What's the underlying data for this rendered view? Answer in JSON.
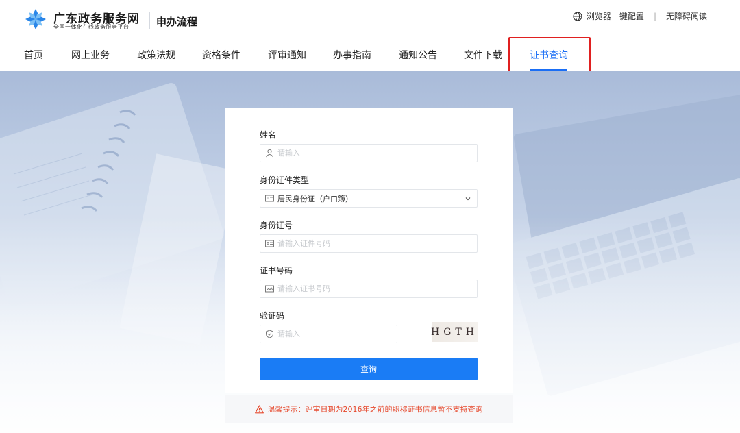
{
  "header": {
    "logo_title": "广东政务服务网",
    "logo_subtitle": "全国一体化在线政务服务平台",
    "section_title": "申办流程",
    "browser_config": "浏览器一键配置",
    "separator": "|",
    "accessibility": "无障碍阅读"
  },
  "nav": {
    "items": [
      {
        "label": "首页"
      },
      {
        "label": "网上业务"
      },
      {
        "label": "政策法规"
      },
      {
        "label": "资格条件"
      },
      {
        "label": "评审通知"
      },
      {
        "label": "办事指南"
      },
      {
        "label": "通知公告"
      },
      {
        "label": "文件下载"
      },
      {
        "label": "证书查询"
      }
    ],
    "active_index": 8
  },
  "form": {
    "name_label": "姓名",
    "name_placeholder": "请输入",
    "id_type_label": "身份证件类型",
    "id_type_value": "居民身份证（户口簿）",
    "id_number_label": "身份证号",
    "id_number_placeholder": "请输入证件号码",
    "cert_number_label": "证书号码",
    "cert_number_placeholder": "请输入证书号码",
    "captcha_label": "验证码",
    "captcha_placeholder": "请输入",
    "captcha_text": "HGTH",
    "submit_label": "查询"
  },
  "notice": {
    "text": "温馨提示：评审日期为2016年之前的职称证书信息暂不支持查询"
  },
  "colors": {
    "accent": "#1a6ef5",
    "button": "#1a7cf5",
    "highlight": "#e02020",
    "warning": "#e6492d"
  }
}
